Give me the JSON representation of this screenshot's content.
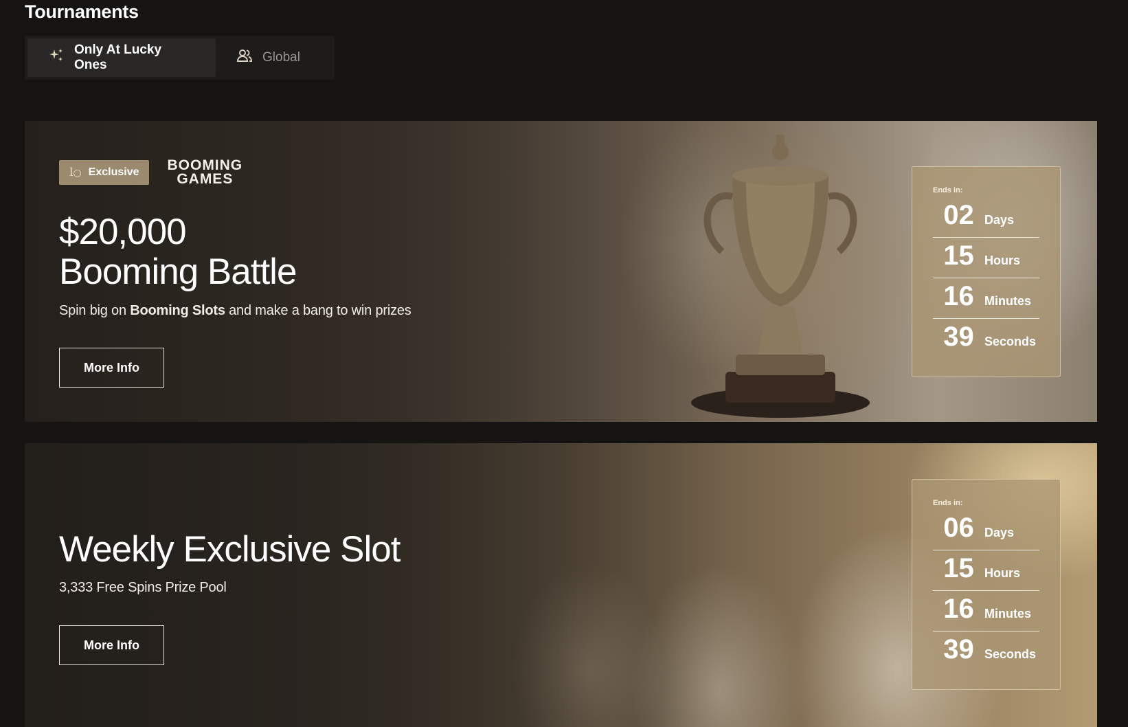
{
  "page": {
    "title": "Tournaments"
  },
  "tabs": [
    {
      "label": "Only At Lucky Ones",
      "icon": "sparkles-icon",
      "active": true
    },
    {
      "label": "Global",
      "icon": "users-icon",
      "active": false
    }
  ],
  "tournaments": [
    {
      "badge": "Exclusive",
      "badge_icon": "lo",
      "provider_line1": "BOOMING",
      "provider_line2": "GAMES",
      "title_line1": "$20,000",
      "title_line2": "Booming Battle",
      "subtitle_pre": "Spin big on ",
      "subtitle_bold": "Booming Slots",
      "subtitle_post": " and make a bang to win prizes",
      "button": "More Info",
      "countdown": {
        "label": "Ends in:",
        "days": "02",
        "days_label": "Days",
        "hours": "15",
        "hours_label": "Hours",
        "minutes": "16",
        "minutes_label": "Minutes",
        "seconds": "39",
        "seconds_label": "Seconds"
      }
    },
    {
      "title_line1": "Weekly Exclusive Slot",
      "subtitle": "3,333 Free Spins Prize Pool",
      "button": "More Info",
      "countdown": {
        "label": "Ends in:",
        "days": "06",
        "days_label": "Days",
        "hours": "15",
        "hours_label": "Hours",
        "minutes": "16",
        "minutes_label": "Minutes",
        "seconds": "39",
        "seconds_label": "Seconds"
      }
    }
  ],
  "colors": {
    "background": "#161412",
    "badge": "#9b8a6e",
    "countdown_panel": "#aa9673"
  }
}
